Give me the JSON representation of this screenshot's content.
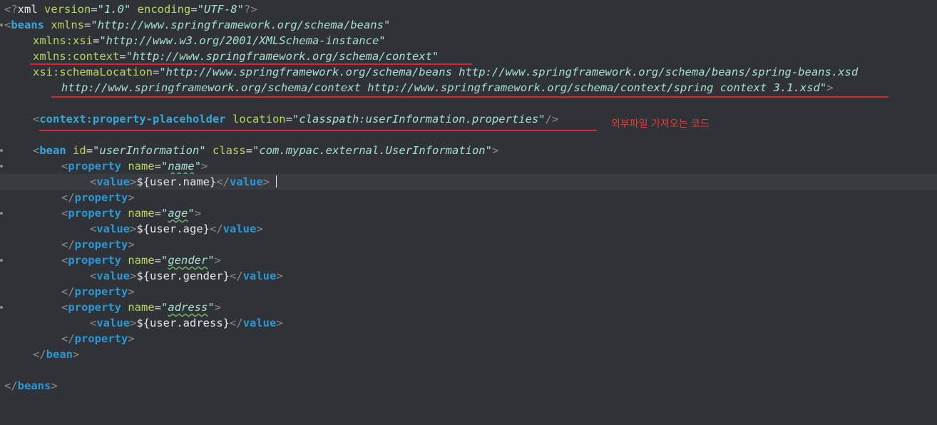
{
  "editor": {
    "language": "xml",
    "colors": {
      "background": "#2f3337",
      "tag": "#3aa6d8",
      "attribute": "#b9d65f",
      "string": "#a8e0cb",
      "annotation": "#e0262d"
    },
    "declaration": {
      "open": "<?xml",
      "version_attr": " version",
      "version_val": "\"1.0\"",
      "encoding_attr": " encoding",
      "encoding_val": "\"UTF-8\"",
      "close": "?>"
    },
    "beans": {
      "tag": "beans",
      "xmlns_attr": "xmlns",
      "xmlns_val": "\"http://www.springframework.org/schema/beans\"",
      "xsi_attr": "xmlns:xsi",
      "xsi_val": "\"http://www.w3.org/2001/XMLSchema-instance\"",
      "context_attr": "xmlns:context",
      "context_val": "\"http://www.springframework.org/schema/context\"",
      "schema_attr": "xsi:schemaLocation",
      "schema_val_1": "\"http://www.springframework.org/schema/beans http://www.springframework.org/schema/beans/spring-beans.xsd",
      "schema_val_2": "http://www.springframework.org/schema/context http://www.springframework.org/schema/context/spring context 3.1.xsd\"",
      "close_tag": "beans"
    },
    "placeholder": {
      "tag": "context:property-placeholder",
      "location_attr": "location",
      "location_val": "\"classpath:userInformation.properties\"",
      "annotation": "외부파일 가져오는 코드"
    },
    "bean": {
      "tag": "bean",
      "id_attr": "id",
      "id_val": "\"userInformation\"",
      "class_attr": "class",
      "class_val": "\"com.mypac.external.UserInformation\"",
      "properties": [
        {
          "name": "name",
          "value": "${user.name}"
        },
        {
          "name": "age",
          "value": "${user.age}"
        },
        {
          "name": "gender",
          "value": "${user.gender}"
        },
        {
          "name": "adress",
          "value": "${user.adress}"
        }
      ]
    },
    "tokens": {
      "property": "property",
      "value": "value",
      "name_attr": "name",
      "eq": "=",
      "q": "\""
    }
  }
}
